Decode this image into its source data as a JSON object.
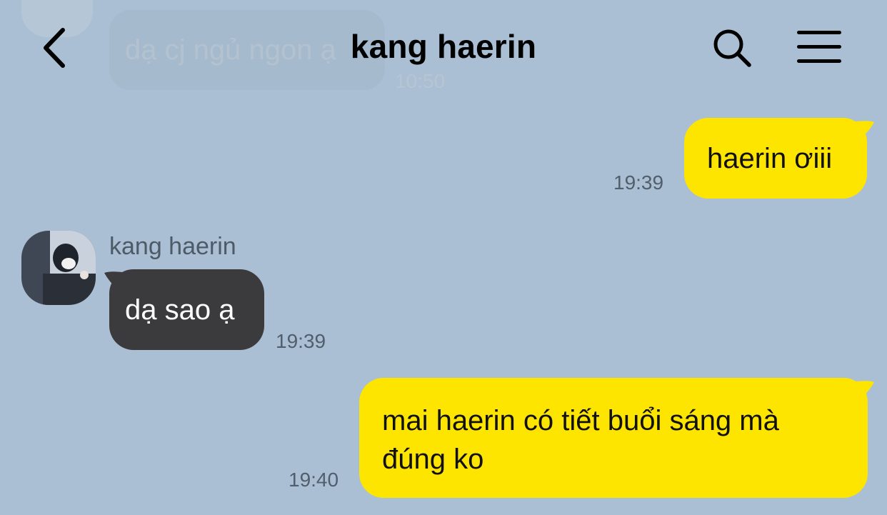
{
  "header": {
    "title": "kang haerin"
  },
  "previous_message": {
    "text": "dạ cj ngủ ngon ạ",
    "time": "10:50"
  },
  "messages": [
    {
      "sender": "me",
      "text": "haerin ơiii",
      "time": "19:39"
    },
    {
      "sender": "kang haerin",
      "sender_name": "kang haerin",
      "text": "dạ sao ạ",
      "time": "19:39"
    },
    {
      "sender": "me",
      "text_line1": "mai haerin có tiết buổi sáng mà",
      "text_line2": "đúng ko",
      "time": "19:40"
    }
  ],
  "icons": {
    "back": "chevron-left-icon",
    "search": "search-icon",
    "menu": "hamburger-menu-icon"
  },
  "colors": {
    "background": "#aabfd3",
    "my_bubble": "#fee500",
    "their_bubble": "#3b3b3d"
  }
}
